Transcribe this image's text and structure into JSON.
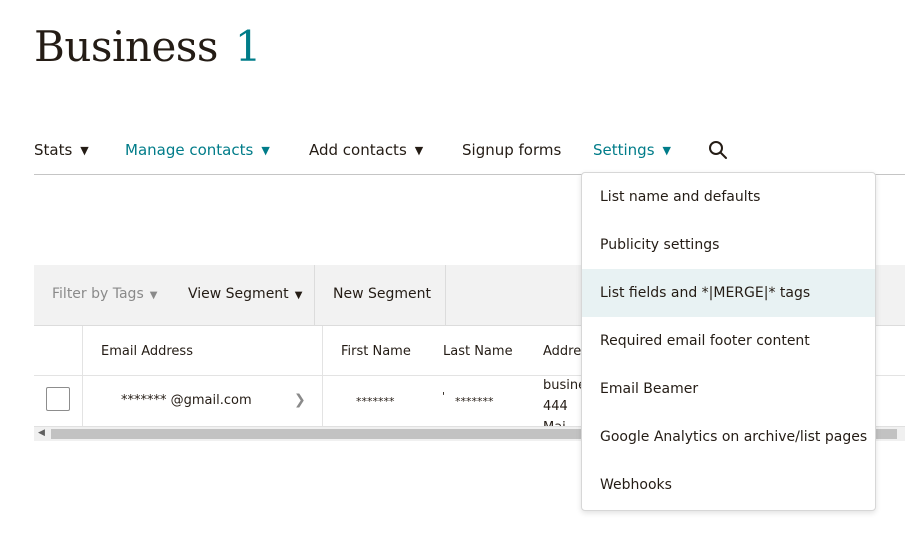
{
  "header": {
    "title": "Business",
    "count": "1"
  },
  "nav": {
    "stats": "Stats",
    "manage_contacts": "Manage contacts",
    "add_contacts": "Add contacts",
    "signup_forms": "Signup forms",
    "settings": "Settings",
    "chevron": "⌄",
    "icons": {
      "search": "search-icon"
    }
  },
  "toolbar": {
    "filter_by_tags": "Filter by Tags",
    "view_segment": "View Segment",
    "new_segment": "New Segment"
  },
  "table": {
    "headers": [
      "Email Address",
      "First Name",
      "Last Name",
      "Addre"
    ],
    "rows": [
      {
        "email": "******* @gmail.com",
        "first_name": "*******",
        "last_name_mark": "'",
        "last_name": "*******",
        "address_line1": "busine",
        "address_line2": "444",
        "address_line3": "Mai"
      }
    ]
  },
  "settings_menu": {
    "active_index": 2,
    "active_color": "#e8f2f3",
    "items": [
      "List name and defaults",
      "Publicity settings",
      "List fields and *|MERGE|* tags",
      "Required email footer content",
      "Email Beamer",
      "Google Analytics on archive/list pages",
      "Webhooks"
    ]
  },
  "colors": {
    "accent": "#007c89",
    "text": "#241c15",
    "toolbar_bg": "#f2f2f2"
  }
}
